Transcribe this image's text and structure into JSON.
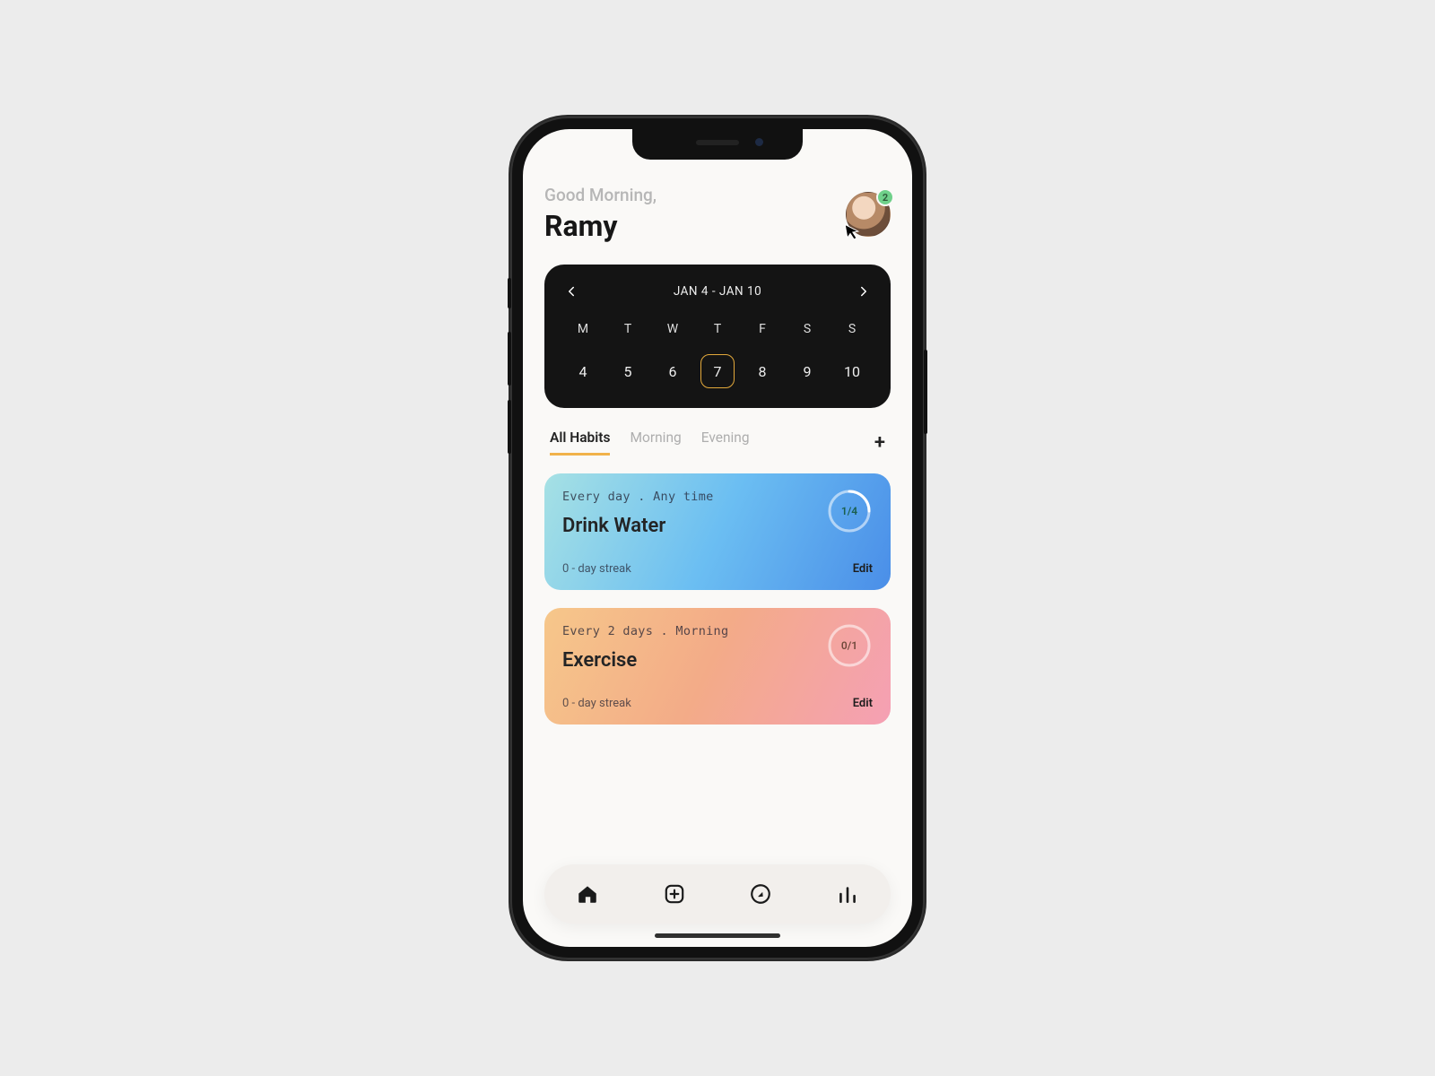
{
  "header": {
    "greeting": "Good Morning,",
    "name": "Ramy",
    "badge_count": "2"
  },
  "calendar": {
    "range": "JAN 4 - JAN 10",
    "dow": [
      "M",
      "T",
      "W",
      "T",
      "F",
      "S",
      "S"
    ],
    "days": [
      "4",
      "5",
      "6",
      "7",
      "8",
      "9",
      "10"
    ],
    "selected_index": 3
  },
  "tabs": {
    "items": [
      "All Habits",
      "Morning",
      "Evening"
    ],
    "active_index": 0
  },
  "habits": [
    {
      "meta": "Every day .  Any time",
      "title": "Drink Water",
      "streak": "0 - day streak",
      "edit": "Edit",
      "progress_label": "1/4",
      "progress_done": 1,
      "progress_total": 4
    },
    {
      "meta": "Every 2 days .  Morning",
      "title": "Exercise",
      "streak": "0 - day streak",
      "edit": "Edit",
      "progress_label": "0/1",
      "progress_done": 0,
      "progress_total": 1
    }
  ],
  "nav": {
    "home": "home-icon",
    "add": "add-icon",
    "explore": "compass-icon",
    "stats": "bar-chart-icon"
  },
  "colors": {
    "accent": "#f1b24a",
    "badge": "#6fd08a"
  }
}
